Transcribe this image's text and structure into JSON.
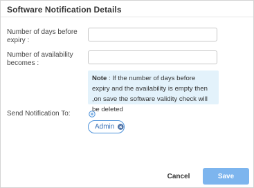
{
  "dialog": {
    "title": "Software Notification Details"
  },
  "form": {
    "days_label": "Number of days before expiry :",
    "days_value": "",
    "availability_label": "Number of availability becomes :",
    "availability_value": ""
  },
  "note": {
    "prefix": "Note",
    "text": " : If the number of days before expiry and the availability is empty then ,on save the software validity check will be deleted"
  },
  "notify": {
    "label": "Send Notification To:",
    "add_icon": "plus-circle-icon",
    "recipients": [
      {
        "label": "Admin",
        "remove_icon": "close-circle-icon"
      }
    ]
  },
  "footer": {
    "cancel_label": "Cancel",
    "save_label": "Save"
  },
  "colors": {
    "accent": "#4a90d9",
    "save_button": "#7db5ee",
    "note_background": "#e3f2fb"
  }
}
